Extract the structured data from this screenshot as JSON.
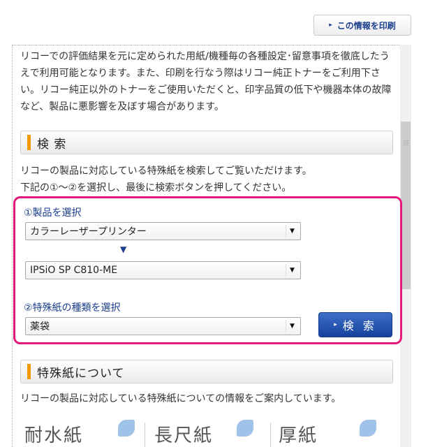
{
  "print_button": {
    "label": "この情報を印刷",
    "arrow": "▸"
  },
  "intro_text": "リコーでの評価結果を元に定められた用紙/機種毎の各種設定･留意事項を徹底したうえで利用可能となります。また、印刷を行なう際はリコー純正トナーをご利用下さい。リコー純正以外のトナーをご使用いただくと、印字品質の低下や機器本体の故障など、製品に悪影響を及ぼす場合があります。",
  "search_section": {
    "title": "検 索",
    "desc_line1": "リコーの製品に対応している特殊紙を検索してご覧いただけます。",
    "desc_line2": "下記の①～②を選択し、最後に検索ボタンを押してください。"
  },
  "form": {
    "step1_label": "①製品を選択",
    "product_category": "カラーレーザープリンター",
    "product_model": "IPSiO SP C810-ME",
    "step2_label": "②特殊紙の種類を選択",
    "paper_type": "薬袋",
    "search_button": "検 索",
    "down_arrow": "▼",
    "caret": "▼"
  },
  "about_section": {
    "title": "特殊紙について",
    "desc": "リコーの製品に対応している特殊紙についての情報をご案内しています。"
  },
  "thumbnails": [
    "耐水紙",
    "長尺紙",
    "厚紙"
  ]
}
